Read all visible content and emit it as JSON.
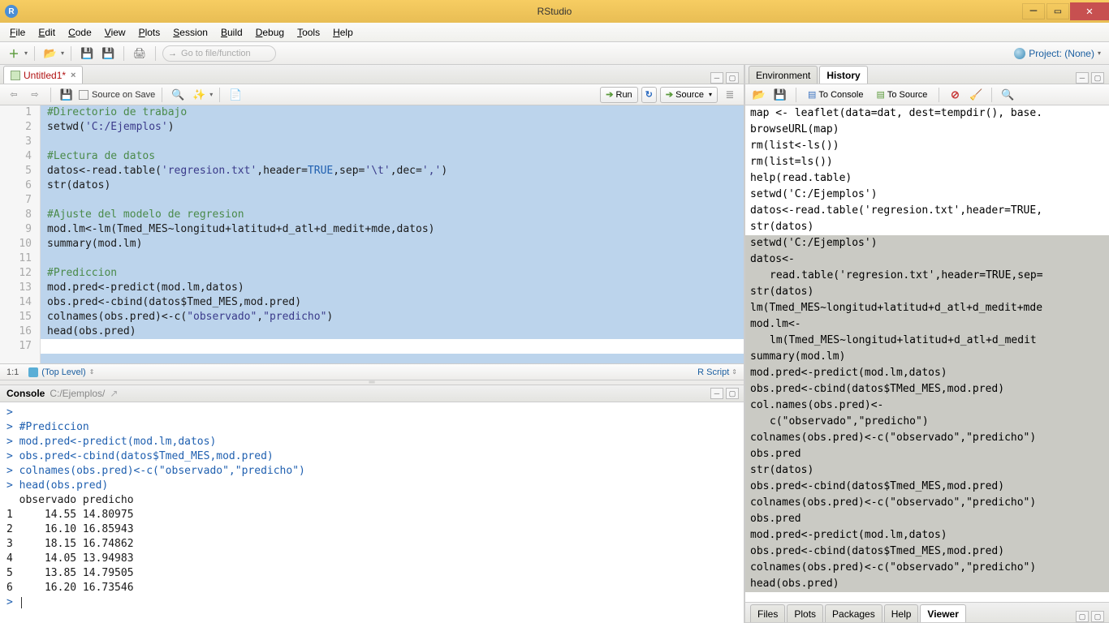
{
  "titlebar": {
    "title": "RStudio"
  },
  "menubar": [
    "File",
    "Edit",
    "Code",
    "View",
    "Plots",
    "Session",
    "Build",
    "Debug",
    "Tools",
    "Help"
  ],
  "toolbar": {
    "file_search_placeholder": "Go to file/function",
    "project_label": "Project: (None)"
  },
  "editor_tab": {
    "name": "Untitled1*",
    "source_on_save": "Source on Save",
    "run": "Run",
    "source": "Source",
    "cursor": "1:1",
    "scope": "(Top Level)",
    "mode": "R Script"
  },
  "code_lines": [
    {
      "n": 1,
      "t": "comment",
      "text": "#Directorio de trabajo"
    },
    {
      "n": 2,
      "t": "call",
      "text": "setwd('C:/Ejemplos')"
    },
    {
      "n": 3,
      "t": "blank",
      "text": ""
    },
    {
      "n": 4,
      "t": "comment",
      "text": "#Lectura de datos"
    },
    {
      "n": 5,
      "t": "read",
      "text": "datos<-read.table('regresion.txt',header=TRUE,sep='\\t',dec=',')"
    },
    {
      "n": 6,
      "t": "plain",
      "text": "str(datos)"
    },
    {
      "n": 7,
      "t": "blank",
      "text": ""
    },
    {
      "n": 8,
      "t": "comment",
      "text": "#Ajuste del modelo de regresion"
    },
    {
      "n": 9,
      "t": "plain",
      "text": "mod.lm<-lm(Tmed_MES~longitud+latitud+d_atl+d_medit+mde,datos)"
    },
    {
      "n": 10,
      "t": "plain",
      "text": "summary(mod.lm)"
    },
    {
      "n": 11,
      "t": "blank",
      "text": ""
    },
    {
      "n": 12,
      "t": "comment",
      "text": "#Prediccion"
    },
    {
      "n": 13,
      "t": "plain",
      "text": "mod.pred<-predict(mod.lm,datos)"
    },
    {
      "n": 14,
      "t": "plain",
      "text": "obs.pred<-cbind(datos$Tmed_MES,mod.pred)"
    },
    {
      "n": 15,
      "t": "cols",
      "text": "colnames(obs.pred)<-c(\"observado\",\"predicho\")"
    },
    {
      "n": 16,
      "t": "plain",
      "text": "head(obs.pred)"
    },
    {
      "n": 17,
      "t": "blank_white",
      "text": ""
    }
  ],
  "console": {
    "title": "Console",
    "path": "C:/Ejemplos/",
    "lines": [
      {
        "p": ">",
        "text": ""
      },
      {
        "p": ">",
        "text": " #Prediccion"
      },
      {
        "p": ">",
        "text": " mod.pred<-predict(mod.lm,datos)"
      },
      {
        "p": ">",
        "text": " obs.pred<-cbind(datos$Tmed_MES,mod.pred)"
      },
      {
        "p": ">",
        "text": " colnames(obs.pred)<-c(\"observado\",\"predicho\")"
      },
      {
        "p": ">",
        "text": " head(obs.pred)"
      }
    ],
    "output": [
      "  observado predicho",
      "1     14.55 14.80975",
      "2     16.10 16.85943",
      "3     18.15 16.74862",
      "4     14.05 13.94983",
      "5     13.85 14.79505",
      "6     16.20 16.73546"
    ],
    "final_prompt": "> "
  },
  "right_tabs": {
    "env": "Environment",
    "hist": "History"
  },
  "history_toolbar": {
    "to_console": "To Console",
    "to_source": "To Source"
  },
  "history_lines": [
    {
      "sel": false,
      "text": "map <- leaflet(data=dat, dest=tempdir(), base."
    },
    {
      "sel": false,
      "text": "browseURL(map)"
    },
    {
      "sel": false,
      "text": "rm(list<-ls())"
    },
    {
      "sel": false,
      "text": "rm(list=ls())"
    },
    {
      "sel": false,
      "text": "help(read.table)"
    },
    {
      "sel": false,
      "text": "setwd('C:/Ejemplos')"
    },
    {
      "sel": false,
      "text": "datos<-read.table('regresion.txt',header=TRUE,"
    },
    {
      "sel": false,
      "text": "str(datos)"
    },
    {
      "sel": true,
      "text": "setwd('C:/Ejemplos')"
    },
    {
      "sel": true,
      "text": "datos<-"
    },
    {
      "sel": true,
      "indent": true,
      "text": "read.table('regresion.txt',header=TRUE,sep="
    },
    {
      "sel": true,
      "text": "str(datos)"
    },
    {
      "sel": true,
      "text": "lm(Tmed_MES~longitud+latitud+d_atl+d_medit+mde"
    },
    {
      "sel": true,
      "text": "mod.lm<-"
    },
    {
      "sel": true,
      "indent": true,
      "text": "lm(Tmed_MES~longitud+latitud+d_atl+d_medit"
    },
    {
      "sel": true,
      "text": "summary(mod.lm)"
    },
    {
      "sel": true,
      "text": "mod.pred<-predict(mod.lm,datos)"
    },
    {
      "sel": true,
      "text": "obs.pred<-cbind(datos$TMed_MES,mod.pred)"
    },
    {
      "sel": true,
      "text": "col.names(obs.pred)<-"
    },
    {
      "sel": true,
      "indent": true,
      "text": "c(\"observado\",\"predicho\")"
    },
    {
      "sel": true,
      "text": "colnames(obs.pred)<-c(\"observado\",\"predicho\")"
    },
    {
      "sel": true,
      "text": "obs.pred"
    },
    {
      "sel": true,
      "text": "str(datos)"
    },
    {
      "sel": true,
      "text": "obs.pred<-cbind(datos$Tmed_MES,mod.pred)"
    },
    {
      "sel": true,
      "text": "colnames(obs.pred)<-c(\"observado\",\"predicho\")"
    },
    {
      "sel": true,
      "text": "obs.pred"
    },
    {
      "sel": true,
      "text": "mod.pred<-predict(mod.lm,datos)"
    },
    {
      "sel": true,
      "text": "obs.pred<-cbind(datos$Tmed_MES,mod.pred)"
    },
    {
      "sel": true,
      "text": "colnames(obs.pred)<-c(\"observado\",\"predicho\")"
    },
    {
      "sel": true,
      "text": "head(obs.pred)"
    }
  ],
  "bottom_right_tabs": [
    "Files",
    "Plots",
    "Packages",
    "Help",
    "Viewer"
  ]
}
